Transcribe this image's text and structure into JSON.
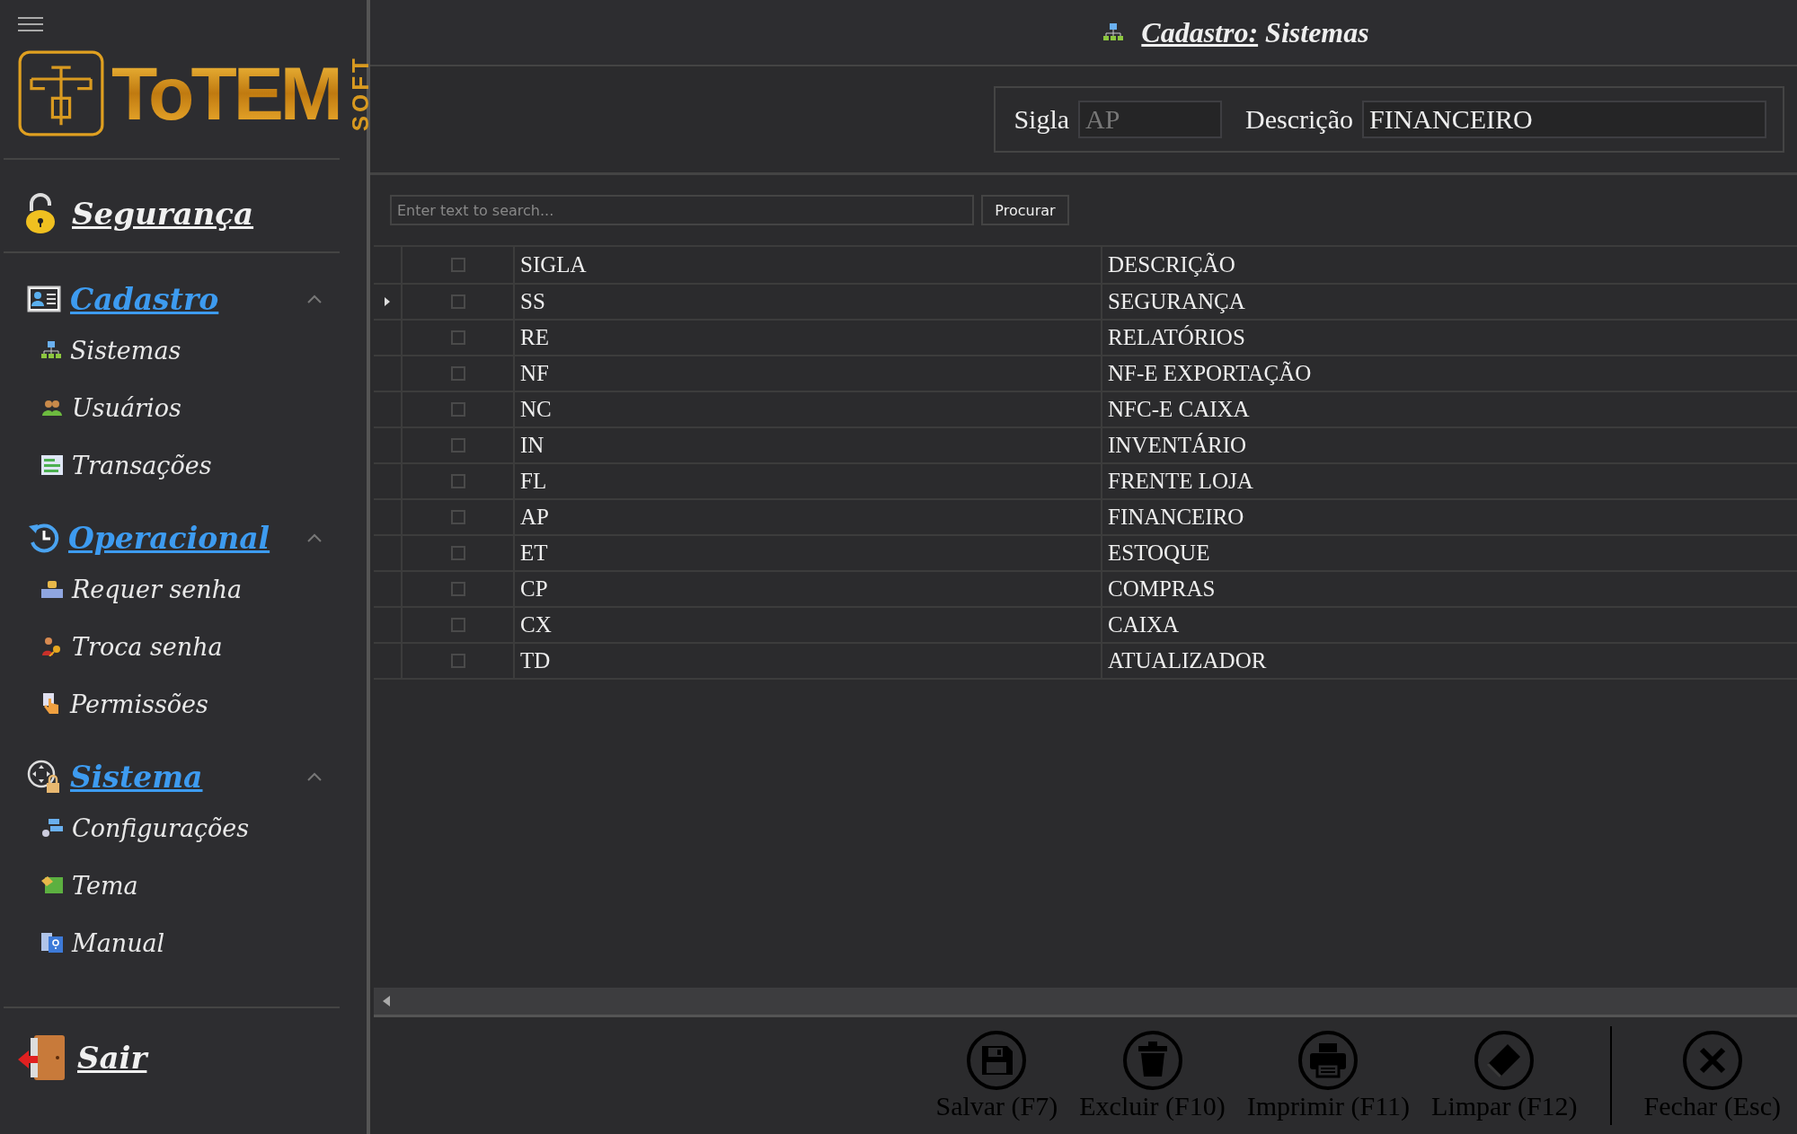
{
  "logo": {
    "wordmark": "ToTEM",
    "suffix": "SOFT"
  },
  "sidebar": {
    "top_link": "Segurança",
    "sections": [
      {
        "title": "Cadastro",
        "expanded": true,
        "items": [
          {
            "label": "Sistemas"
          },
          {
            "label": "Usuários"
          },
          {
            "label": "Transações"
          }
        ]
      },
      {
        "title": "Operacional",
        "expanded": true,
        "items": [
          {
            "label": "Requer senha"
          },
          {
            "label": "Troca senha"
          },
          {
            "label": "Permissões"
          }
        ]
      },
      {
        "title": "Sistema",
        "expanded": true,
        "items": [
          {
            "label": "Configurações"
          },
          {
            "label": "Tema"
          },
          {
            "label": "Manual"
          }
        ]
      }
    ],
    "exit": "Sair"
  },
  "header": {
    "prefix": "Cadastro:",
    "title": "Sistemas"
  },
  "form": {
    "sigla_label": "Sigla",
    "sigla_value": "AP",
    "descricao_label": "Descrição",
    "descricao_value": "FINANCEIRO"
  },
  "search": {
    "placeholder": "Enter text to search...",
    "button": "Procurar"
  },
  "table": {
    "header_checked": false,
    "columns": [
      "SIGLA",
      "DESCRIÇÃO"
    ],
    "rows": [
      {
        "sigla": "SS",
        "descricao": "SEGURANÇA",
        "selected": true,
        "checked": false
      },
      {
        "sigla": "RE",
        "descricao": "RELATÓRIOS",
        "selected": false,
        "checked": false
      },
      {
        "sigla": "NF",
        "descricao": "NF-E EXPORTAÇÃO",
        "selected": false,
        "checked": false
      },
      {
        "sigla": "NC",
        "descricao": "NFC-E CAIXA",
        "selected": false,
        "checked": false
      },
      {
        "sigla": "IN",
        "descricao": "INVENTÁRIO",
        "selected": false,
        "checked": false
      },
      {
        "sigla": "FL",
        "descricao": "FRENTE LOJA",
        "selected": false,
        "checked": false
      },
      {
        "sigla": "AP",
        "descricao": "FINANCEIRO",
        "selected": false,
        "checked": false
      },
      {
        "sigla": "ET",
        "descricao": "ESTOQUE",
        "selected": false,
        "checked": false
      },
      {
        "sigla": "CP",
        "descricao": "COMPRAS",
        "selected": false,
        "checked": false
      },
      {
        "sigla": "CX",
        "descricao": "CAIXA",
        "selected": false,
        "checked": false
      },
      {
        "sigla": "TD",
        "descricao": "ATUALIZADOR",
        "selected": false,
        "checked": false
      }
    ]
  },
  "toolbar": [
    {
      "label": "Salvar (F7)",
      "kind": "save"
    },
    {
      "label": "Excluir (F10)",
      "kind": "delete"
    },
    {
      "label": "Imprimir (F11)",
      "kind": "print"
    },
    {
      "label": "Limpar (F12)",
      "kind": "clear"
    },
    {
      "label": "Fechar (Esc)",
      "kind": "close"
    }
  ]
}
